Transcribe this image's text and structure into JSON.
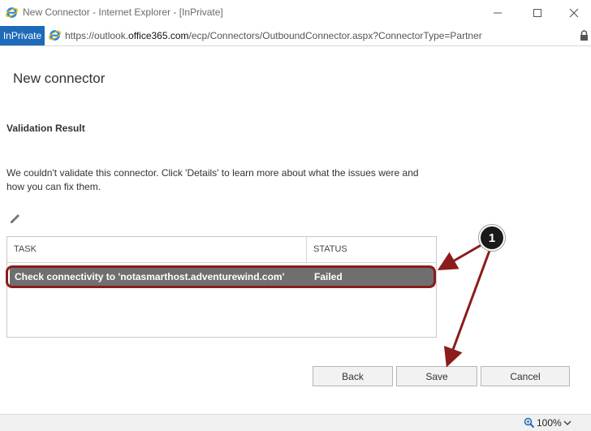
{
  "window": {
    "title": "New Connector - Internet Explorer - [InPrivate]",
    "inprivate_label": "InPrivate",
    "url_prefix": "https://outlook.",
    "url_domain": "office365.com",
    "url_suffix": "/ecp/Connectors/OutboundConnector.aspx?ConnectorType=Partner",
    "minimize_icon": "minimize-icon",
    "maximize_icon": "maximize-icon",
    "close_icon": "close-icon"
  },
  "page": {
    "heading": "New connector",
    "section_title": "Validation Result",
    "message": "We couldn't validate this connector. Click 'Details' to learn more about what the issues were and how you can fix them."
  },
  "grid": {
    "columns": [
      "TASK",
      "STATUS"
    ],
    "rows": [
      {
        "task": "Check connectivity to 'notasmarthost.adventurewind.com'",
        "status": "Failed"
      }
    ]
  },
  "buttons": {
    "back": "Back",
    "save": "Save",
    "cancel": "Cancel"
  },
  "annotation": {
    "callout_number": "1",
    "color": "#8c1c1c"
  },
  "statusbar": {
    "zoom": "100%"
  }
}
